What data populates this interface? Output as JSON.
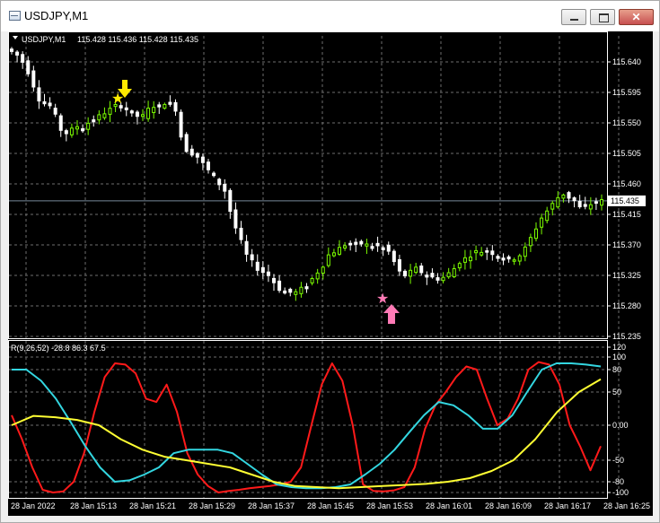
{
  "window": {
    "title": "USDJPY,M1",
    "controls": {
      "minimize_icon": "minimize-icon",
      "maximize_icon": "maximize-icon",
      "close_icon": "close-icon",
      "close_glyph": "✕"
    }
  },
  "header": {
    "symbol": "USDJPY,M1",
    "ohlc": "115.428 115.436 115.428 115.435",
    "indicator": "R(9,26,52) -28.8 86.3 67.5"
  },
  "colors": {
    "background": "#000000",
    "grid": "#6e6e6e",
    "bull": "#7cfc00",
    "bear": "#ffffff",
    "current_price_line": "#778899",
    "red_line": "#ff1a1a",
    "cyan_line": "#33d6e0",
    "yellow_line": "#ffff33",
    "sell_arrow": "#ffea00",
    "buy_arrow": "#ff7ab6"
  },
  "chart_data": [
    {
      "type": "candlestick",
      "symbol": "USDJPY",
      "timeframe": "M1",
      "ylim": [
        115.235,
        115.685
      ],
      "y_ticks": [
        "115.640",
        "115.595",
        "115.550",
        "115.505",
        "115.460",
        "115.415",
        "115.370",
        "115.325",
        "115.280",
        "115.235"
      ],
      "current_price": "115.435",
      "x_ticks": [
        "28 Jan 2022",
        "28 Jan 15:13",
        "28 Jan 15:21",
        "28 Jan 15:29",
        "28 Jan 15:37",
        "28 Jan 15:45",
        "28 Jan 15:53",
        "28 Jan 16:01",
        "28 Jan 16:09",
        "28 Jan 16:17",
        "28 Jan 16:25"
      ],
      "close_path": [
        115.655,
        115.65,
        115.64,
        115.625,
        115.605,
        115.585,
        115.58,
        115.575,
        115.56,
        115.54,
        115.535,
        115.54,
        115.545,
        115.545,
        115.55,
        115.555,
        115.56,
        115.565,
        115.57,
        115.575,
        115.575,
        115.57,
        115.565,
        115.56,
        115.56,
        115.57,
        115.575,
        115.575,
        115.58,
        115.58,
        115.57,
        115.53,
        115.51,
        115.505,
        115.5,
        115.49,
        115.48,
        115.47,
        115.46,
        115.45,
        115.42,
        115.395,
        115.375,
        115.355,
        115.345,
        115.335,
        115.33,
        115.325,
        115.315,
        115.305,
        115.3,
        115.3,
        115.3,
        115.305,
        115.31,
        115.32,
        115.33,
        115.34,
        115.355,
        115.36,
        115.365,
        115.37,
        115.37,
        115.372,
        115.372,
        115.37,
        115.368,
        115.368,
        115.365,
        115.36,
        115.345,
        115.33,
        115.325,
        115.33,
        115.335,
        115.33,
        115.325,
        115.322,
        115.32,
        115.322,
        115.328,
        115.335,
        115.345,
        115.35,
        115.355,
        115.36,
        115.36,
        115.36,
        115.358,
        115.355,
        115.352,
        115.35,
        115.35,
        115.355,
        115.365,
        115.38,
        115.395,
        115.41,
        115.42,
        115.43,
        115.44,
        115.445,
        115.44,
        115.435,
        115.425,
        115.425,
        115.43,
        115.432,
        115.435
      ],
      "markers": [
        {
          "type": "sell-arrow",
          "time": "28 Jan 15:16"
        },
        {
          "type": "buy-arrow",
          "time": "28 Jan 15:53"
        }
      ]
    },
    {
      "type": "line",
      "title": "R(9,26,52)",
      "values_label": "-28.8 86.3 67.5",
      "ylim": [
        -110,
        120
      ],
      "y_ticks": [
        "120",
        "100",
        "80",
        "50",
        "0.00",
        "-50",
        "-80",
        "-100"
      ],
      "series": [
        {
          "color": "#ff1a1a",
          "values": [
            15,
            -20,
            -60,
            -95,
            -100,
            -98,
            -80,
            -40,
            20,
            70,
            90,
            88,
            75,
            40,
            35,
            60,
            20,
            -40,
            -70,
            -88,
            -100,
            -97,
            -95,
            -92,
            -90,
            -88,
            -85,
            -80,
            -60,
            0,
            60,
            90,
            65,
            0,
            -85,
            -97,
            -98,
            -96,
            -90,
            -60,
            -5,
            30,
            50,
            70,
            85,
            80,
            40,
            0,
            10,
            40,
            80,
            92,
            88,
            60,
            0,
            -30,
            -64,
            -30
          ]
        },
        {
          "color": "#33d6e0",
          "values": [
            80,
            80,
            65,
            40,
            5,
            -30,
            -60,
            -80,
            -78,
            -70,
            -60,
            -40,
            -35,
            -35,
            -35,
            -40,
            -55,
            -70,
            -85,
            -90,
            -92,
            -92,
            -90,
            -85,
            -70,
            -55,
            -35,
            -10,
            15,
            35,
            30,
            15,
            -5,
            -5,
            15,
            50,
            80,
            90,
            90,
            88,
            85
          ]
        },
        {
          "color": "#ffff33",
          "values": [
            0,
            14,
            12,
            8,
            0,
            -20,
            -35,
            -45,
            -50,
            -55,
            -60,
            -70,
            -80,
            -88,
            -90,
            -92,
            -90,
            -88,
            -86,
            -84,
            -80,
            -75,
            -65,
            -50,
            -20,
            20,
            50,
            67
          ]
        }
      ]
    }
  ]
}
